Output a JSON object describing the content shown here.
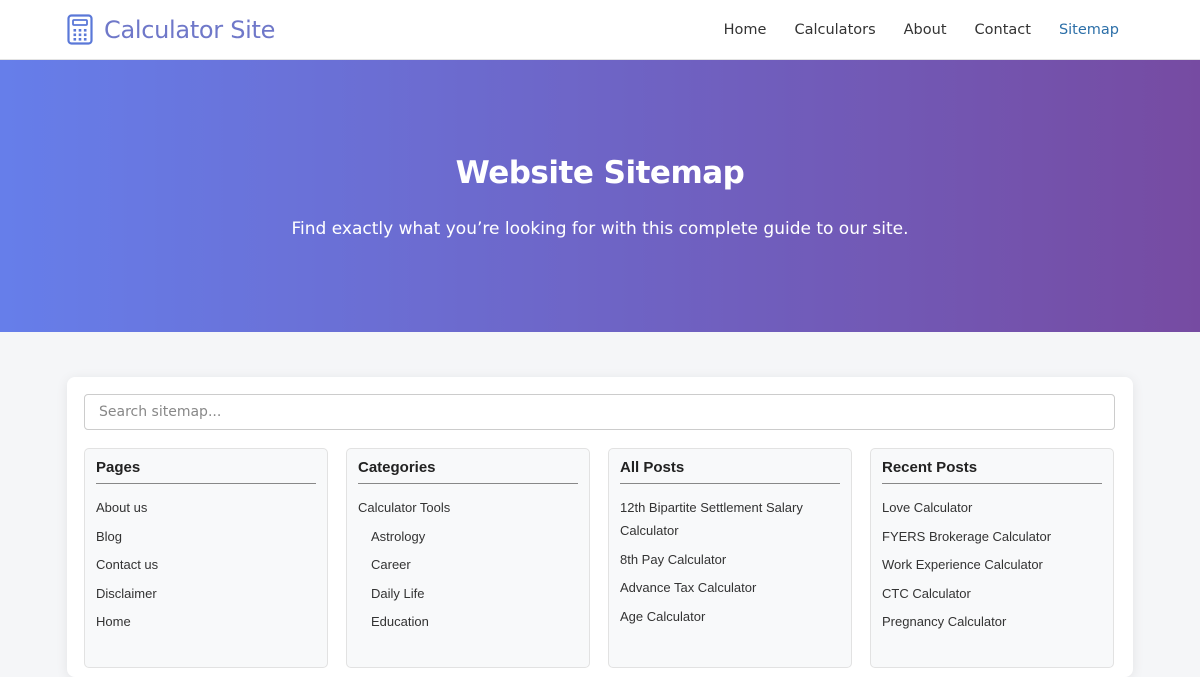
{
  "header": {
    "logo_text": "Calculator Site",
    "nav": [
      {
        "label": "Home"
      },
      {
        "label": "Calculators"
      },
      {
        "label": "About"
      },
      {
        "label": "Contact"
      },
      {
        "label": "Sitemap",
        "active": true
      }
    ]
  },
  "hero": {
    "title": "Website Sitemap",
    "subtitle": "Find exactly what you’re looking for with this complete guide to our site."
  },
  "search": {
    "placeholder": "Search sitemap..."
  },
  "columns": [
    {
      "title": "Pages",
      "items": [
        "About us",
        "Blog",
        "Contact us",
        "Disclaimer",
        "Home"
      ]
    },
    {
      "title": "Categories",
      "items": [
        "Calculator Tools",
        "Astrology",
        "Career",
        "Daily Life",
        "Education"
      ]
    },
    {
      "title": "All Posts",
      "items": [
        "12th Bipartite Settlement Salary Calculator",
        "8th Pay Calculator",
        "Advance Tax Calculator",
        "Age Calculator"
      ]
    },
    {
      "title": "Recent Posts",
      "items": [
        "Love Calculator",
        "FYERS Brokerage Calculator",
        "Work Experience Calculator",
        "CTC Calculator",
        "Pregnancy Calculator"
      ]
    }
  ],
  "colors": {
    "accent": "#6f78c9",
    "nav_active": "#2c6fa8",
    "hero_start": "#667eea",
    "hero_end": "#764ba2"
  },
  "icons": {
    "logo": "calculator-icon"
  }
}
